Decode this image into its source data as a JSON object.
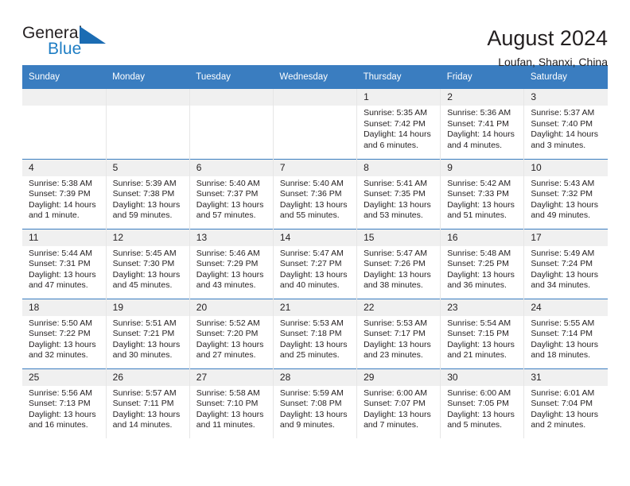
{
  "brand": {
    "name_part1": "General",
    "name_part2": "Blue",
    "triangle_color": "#1b6cb3",
    "blue_text_color": "#1f7ec4"
  },
  "header": {
    "title": "August 2024",
    "location": "Loufan, Shanxi, China",
    "accent_color": "#3a7dc0"
  },
  "weekdays": [
    "Sunday",
    "Monday",
    "Tuesday",
    "Wednesday",
    "Thursday",
    "Friday",
    "Saturday"
  ],
  "labels": {
    "sunrise": "Sunrise:",
    "sunset": "Sunset:",
    "daylight": "Daylight:"
  },
  "weeks": [
    [
      {
        "day": "",
        "empty": true
      },
      {
        "day": "",
        "empty": true
      },
      {
        "day": "",
        "empty": true
      },
      {
        "day": "",
        "empty": true
      },
      {
        "day": "1",
        "sunrise": "Sunrise: 5:35 AM",
        "sunset": "Sunset: 7:42 PM",
        "daylight_line1": "Daylight: 14 hours",
        "daylight_line2": "and 6 minutes."
      },
      {
        "day": "2",
        "sunrise": "Sunrise: 5:36 AM",
        "sunset": "Sunset: 7:41 PM",
        "daylight_line1": "Daylight: 14 hours",
        "daylight_line2": "and 4 minutes."
      },
      {
        "day": "3",
        "sunrise": "Sunrise: 5:37 AM",
        "sunset": "Sunset: 7:40 PM",
        "daylight_line1": "Daylight: 14 hours",
        "daylight_line2": "and 3 minutes."
      }
    ],
    [
      {
        "day": "4",
        "sunrise": "Sunrise: 5:38 AM",
        "sunset": "Sunset: 7:39 PM",
        "daylight_line1": "Daylight: 14 hours",
        "daylight_line2": "and 1 minute."
      },
      {
        "day": "5",
        "sunrise": "Sunrise: 5:39 AM",
        "sunset": "Sunset: 7:38 PM",
        "daylight_line1": "Daylight: 13 hours",
        "daylight_line2": "and 59 minutes."
      },
      {
        "day": "6",
        "sunrise": "Sunrise: 5:40 AM",
        "sunset": "Sunset: 7:37 PM",
        "daylight_line1": "Daylight: 13 hours",
        "daylight_line2": "and 57 minutes."
      },
      {
        "day": "7",
        "sunrise": "Sunrise: 5:40 AM",
        "sunset": "Sunset: 7:36 PM",
        "daylight_line1": "Daylight: 13 hours",
        "daylight_line2": "and 55 minutes."
      },
      {
        "day": "8",
        "sunrise": "Sunrise: 5:41 AM",
        "sunset": "Sunset: 7:35 PM",
        "daylight_line1": "Daylight: 13 hours",
        "daylight_line2": "and 53 minutes."
      },
      {
        "day": "9",
        "sunrise": "Sunrise: 5:42 AM",
        "sunset": "Sunset: 7:33 PM",
        "daylight_line1": "Daylight: 13 hours",
        "daylight_line2": "and 51 minutes."
      },
      {
        "day": "10",
        "sunrise": "Sunrise: 5:43 AM",
        "sunset": "Sunset: 7:32 PM",
        "daylight_line1": "Daylight: 13 hours",
        "daylight_line2": "and 49 minutes."
      }
    ],
    [
      {
        "day": "11",
        "sunrise": "Sunrise: 5:44 AM",
        "sunset": "Sunset: 7:31 PM",
        "daylight_line1": "Daylight: 13 hours",
        "daylight_line2": "and 47 minutes."
      },
      {
        "day": "12",
        "sunrise": "Sunrise: 5:45 AM",
        "sunset": "Sunset: 7:30 PM",
        "daylight_line1": "Daylight: 13 hours",
        "daylight_line2": "and 45 minutes."
      },
      {
        "day": "13",
        "sunrise": "Sunrise: 5:46 AM",
        "sunset": "Sunset: 7:29 PM",
        "daylight_line1": "Daylight: 13 hours",
        "daylight_line2": "and 43 minutes."
      },
      {
        "day": "14",
        "sunrise": "Sunrise: 5:47 AM",
        "sunset": "Sunset: 7:27 PM",
        "daylight_line1": "Daylight: 13 hours",
        "daylight_line2": "and 40 minutes."
      },
      {
        "day": "15",
        "sunrise": "Sunrise: 5:47 AM",
        "sunset": "Sunset: 7:26 PM",
        "daylight_line1": "Daylight: 13 hours",
        "daylight_line2": "and 38 minutes."
      },
      {
        "day": "16",
        "sunrise": "Sunrise: 5:48 AM",
        "sunset": "Sunset: 7:25 PM",
        "daylight_line1": "Daylight: 13 hours",
        "daylight_line2": "and 36 minutes."
      },
      {
        "day": "17",
        "sunrise": "Sunrise: 5:49 AM",
        "sunset": "Sunset: 7:24 PM",
        "daylight_line1": "Daylight: 13 hours",
        "daylight_line2": "and 34 minutes."
      }
    ],
    [
      {
        "day": "18",
        "sunrise": "Sunrise: 5:50 AM",
        "sunset": "Sunset: 7:22 PM",
        "daylight_line1": "Daylight: 13 hours",
        "daylight_line2": "and 32 minutes."
      },
      {
        "day": "19",
        "sunrise": "Sunrise: 5:51 AM",
        "sunset": "Sunset: 7:21 PM",
        "daylight_line1": "Daylight: 13 hours",
        "daylight_line2": "and 30 minutes."
      },
      {
        "day": "20",
        "sunrise": "Sunrise: 5:52 AM",
        "sunset": "Sunset: 7:20 PM",
        "daylight_line1": "Daylight: 13 hours",
        "daylight_line2": "and 27 minutes."
      },
      {
        "day": "21",
        "sunrise": "Sunrise: 5:53 AM",
        "sunset": "Sunset: 7:18 PM",
        "daylight_line1": "Daylight: 13 hours",
        "daylight_line2": "and 25 minutes."
      },
      {
        "day": "22",
        "sunrise": "Sunrise: 5:53 AM",
        "sunset": "Sunset: 7:17 PM",
        "daylight_line1": "Daylight: 13 hours",
        "daylight_line2": "and 23 minutes."
      },
      {
        "day": "23",
        "sunrise": "Sunrise: 5:54 AM",
        "sunset": "Sunset: 7:15 PM",
        "daylight_line1": "Daylight: 13 hours",
        "daylight_line2": "and 21 minutes."
      },
      {
        "day": "24",
        "sunrise": "Sunrise: 5:55 AM",
        "sunset": "Sunset: 7:14 PM",
        "daylight_line1": "Daylight: 13 hours",
        "daylight_line2": "and 18 minutes."
      }
    ],
    [
      {
        "day": "25",
        "sunrise": "Sunrise: 5:56 AM",
        "sunset": "Sunset: 7:13 PM",
        "daylight_line1": "Daylight: 13 hours",
        "daylight_line2": "and 16 minutes."
      },
      {
        "day": "26",
        "sunrise": "Sunrise: 5:57 AM",
        "sunset": "Sunset: 7:11 PM",
        "daylight_line1": "Daylight: 13 hours",
        "daylight_line2": "and 14 minutes."
      },
      {
        "day": "27",
        "sunrise": "Sunrise: 5:58 AM",
        "sunset": "Sunset: 7:10 PM",
        "daylight_line1": "Daylight: 13 hours",
        "daylight_line2": "and 11 minutes."
      },
      {
        "day": "28",
        "sunrise": "Sunrise: 5:59 AM",
        "sunset": "Sunset: 7:08 PM",
        "daylight_line1": "Daylight: 13 hours",
        "daylight_line2": "and 9 minutes."
      },
      {
        "day": "29",
        "sunrise": "Sunrise: 6:00 AM",
        "sunset": "Sunset: 7:07 PM",
        "daylight_line1": "Daylight: 13 hours",
        "daylight_line2": "and 7 minutes."
      },
      {
        "day": "30",
        "sunrise": "Sunrise: 6:00 AM",
        "sunset": "Sunset: 7:05 PM",
        "daylight_line1": "Daylight: 13 hours",
        "daylight_line2": "and 5 minutes."
      },
      {
        "day": "31",
        "sunrise": "Sunrise: 6:01 AM",
        "sunset": "Sunset: 7:04 PM",
        "daylight_line1": "Daylight: 13 hours",
        "daylight_line2": "and 2 minutes."
      }
    ]
  ]
}
